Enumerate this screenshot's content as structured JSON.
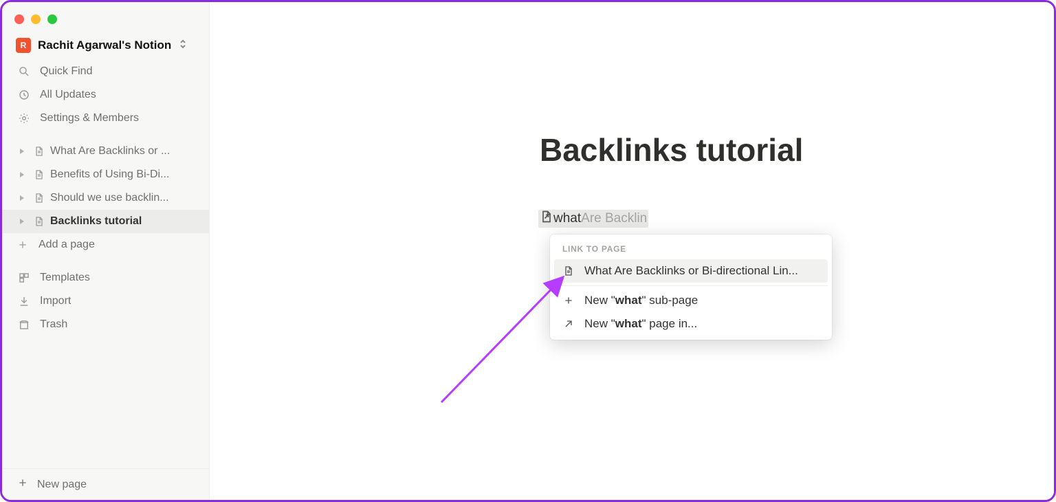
{
  "workspace": {
    "avatar_letter": "R",
    "name": "Rachit Agarwal's Notion"
  },
  "sidebar": {
    "quick_find": "Quick Find",
    "all_updates": "All Updates",
    "settings_members": "Settings & Members",
    "pages": [
      {
        "label": "What Are Backlinks or ..."
      },
      {
        "label": "Benefits of Using Bi-Di..."
      },
      {
        "label": "Should we use backlin..."
      },
      {
        "label": "Backlinks tutorial"
      }
    ],
    "add_page": "Add a page",
    "templates": "Templates",
    "import": "Import",
    "trash": "Trash",
    "new_page": "New page"
  },
  "main": {
    "page_title": "Backlinks tutorial",
    "inline_link": {
      "typed": "what",
      "ghost": " Are Backlin"
    },
    "popup": {
      "heading": "LINK TO PAGE",
      "result": "What Are Backlinks or Bi-directional Lin...",
      "new_sub_prefix": "New \"",
      "new_sub_term": "what",
      "new_sub_suffix": "\" sub-page",
      "new_in_prefix": "New \"",
      "new_in_term": "what",
      "new_in_suffix": "\" page in..."
    }
  }
}
